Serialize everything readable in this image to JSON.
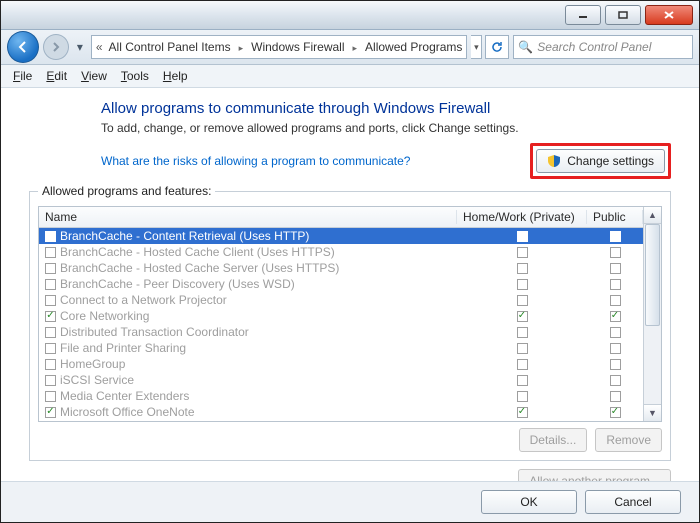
{
  "titlebar": {
    "min": "–",
    "max": "▢",
    "close": "✕"
  },
  "nav": {
    "back": "←",
    "fwd": "→",
    "crumbs": [
      "All Control Panel Items",
      "Windows Firewall",
      "Allowed Programs"
    ]
  },
  "search": {
    "placeholder": "Search Control Panel"
  },
  "menu": {
    "file": "File",
    "edit": "Edit",
    "view": "View",
    "tools": "Tools",
    "help": "Help"
  },
  "page": {
    "title": "Allow programs to communicate through Windows Firewall",
    "subtitle": "To add, change, or remove allowed programs and ports, click Change settings.",
    "risk_link": "What are the risks of allowing a program to communicate?",
    "change_settings": "Change settings"
  },
  "group": {
    "label": "Allowed programs and features:",
    "columns": {
      "name": "Name",
      "homework": "Home/Work (Private)",
      "public": "Public"
    },
    "rows": [
      {
        "name": "BranchCache - Content Retrieval (Uses HTTP)",
        "allowed": false,
        "hw": false,
        "pub": false,
        "selected": true
      },
      {
        "name": "BranchCache - Hosted Cache Client (Uses HTTPS)",
        "allowed": false,
        "hw": false,
        "pub": false,
        "selected": false
      },
      {
        "name": "BranchCache - Hosted Cache Server (Uses HTTPS)",
        "allowed": false,
        "hw": false,
        "pub": false,
        "selected": false
      },
      {
        "name": "BranchCache - Peer Discovery (Uses WSD)",
        "allowed": false,
        "hw": false,
        "pub": false,
        "selected": false
      },
      {
        "name": "Connect to a Network Projector",
        "allowed": false,
        "hw": false,
        "pub": false,
        "selected": false
      },
      {
        "name": "Core Networking",
        "allowed": true,
        "hw": true,
        "pub": true,
        "selected": false
      },
      {
        "name": "Distributed Transaction Coordinator",
        "allowed": false,
        "hw": false,
        "pub": false,
        "selected": false
      },
      {
        "name": "File and Printer Sharing",
        "allowed": false,
        "hw": false,
        "pub": false,
        "selected": false
      },
      {
        "name": "HomeGroup",
        "allowed": false,
        "hw": false,
        "pub": false,
        "selected": false
      },
      {
        "name": "iSCSI Service",
        "allowed": false,
        "hw": false,
        "pub": false,
        "selected": false
      },
      {
        "name": "Media Center Extenders",
        "allowed": false,
        "hw": false,
        "pub": false,
        "selected": false
      },
      {
        "name": "Microsoft Office OneNote",
        "allowed": true,
        "hw": true,
        "pub": true,
        "selected": false
      }
    ],
    "details": "Details...",
    "remove": "Remove",
    "allow_another": "Allow another program..."
  },
  "footer": {
    "ok": "OK",
    "cancel": "Cancel"
  }
}
